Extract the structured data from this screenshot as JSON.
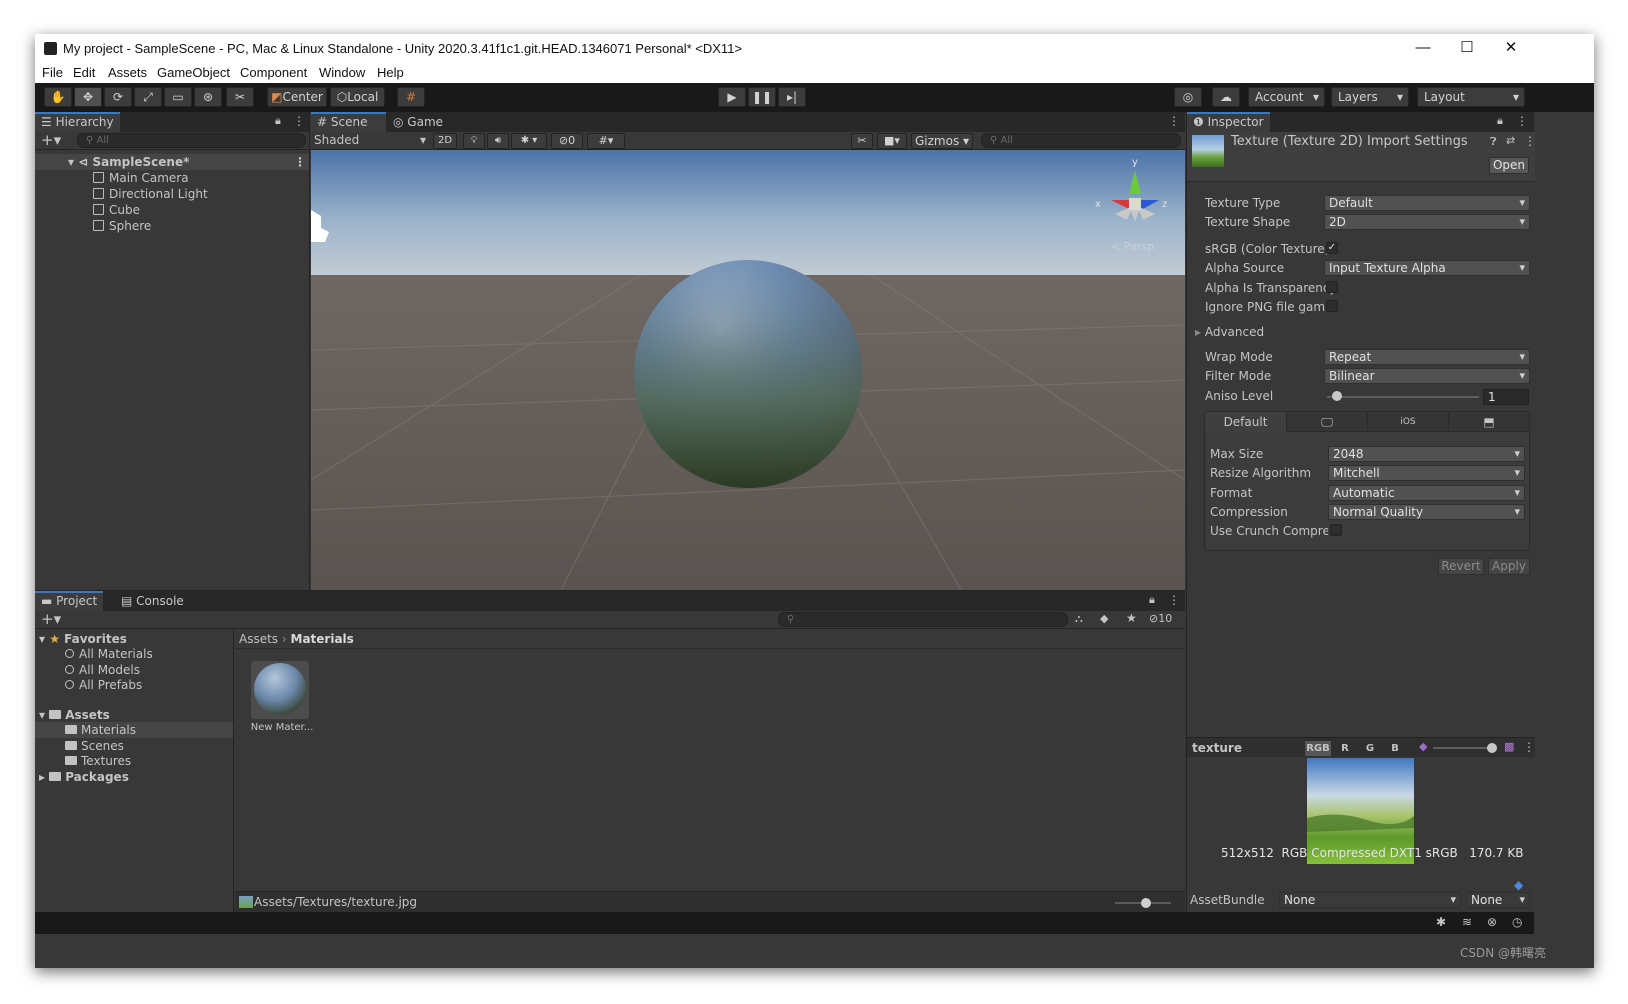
{
  "window": {
    "title": "My project - SampleScene - PC, Mac & Linux Standalone - Unity 2020.3.41f1c1.git.HEAD.1346071 Personal* <DX11>",
    "minimize": "—",
    "maximize": "☐",
    "close": "✕"
  },
  "menu": [
    "File",
    "Edit",
    "Assets",
    "GameObject",
    "Component",
    "Window",
    "Help"
  ],
  "toolbar": {
    "pivot": "Center",
    "space": "Local",
    "account": "Account",
    "layers": "Layers",
    "layout": "Layout"
  },
  "hierarchy": {
    "tab": "Hierarchy",
    "search_placeholder": "All",
    "scene": "SampleScene*",
    "items": [
      "Main Camera",
      "Directional Light",
      "Cube",
      "Sphere"
    ]
  },
  "scene_view": {
    "tab_scene": "Scene",
    "tab_game": "Game",
    "shading": "Shaded",
    "mode2d": "2D",
    "hidden_count": "0",
    "gizmos": "Gizmos",
    "search_placeholder": "All",
    "persp": "< Persp",
    "axis_x": "x",
    "axis_y": "y",
    "axis_z": "z"
  },
  "project": {
    "tab_project": "Project",
    "tab_console": "Console",
    "favorites_label": "Favorites",
    "favorites": [
      "All Materials",
      "All Models",
      "All Prefabs"
    ],
    "assets_label": "Assets",
    "asset_folders": [
      "Materials",
      "Scenes",
      "Textures"
    ],
    "packages_label": "Packages",
    "breadcrumb_root": "Assets",
    "breadcrumb_current": "Materials",
    "hidden_count": "10",
    "asset_item": "New Mater...",
    "footer_path": "Assets/Textures/texture.jpg"
  },
  "inspector": {
    "tab": "Inspector",
    "header_title": "Texture (Texture 2D) Import Settings",
    "open_button": "Open",
    "fields": {
      "texture_type_label": "Texture Type",
      "texture_type": "Default",
      "texture_shape_label": "Texture Shape",
      "texture_shape": "2D",
      "srgb_label": "sRGB (Color Texture)",
      "srgb_checked": "✓",
      "alpha_source_label": "Alpha Source",
      "alpha_source": "Input Texture Alpha",
      "alpha_transparency_label": "Alpha Is Transparency",
      "ignore_png_label": "Ignore PNG file gamm",
      "advanced_label": "Advanced",
      "wrap_mode_label": "Wrap Mode",
      "wrap_mode": "Repeat",
      "filter_mode_label": "Filter Mode",
      "filter_mode": "Bilinear",
      "aniso_label": "Aniso Level",
      "aniso_value": "1"
    },
    "platform_tabs": [
      "Default",
      "iOS"
    ],
    "platform": {
      "max_size_label": "Max Size",
      "max_size": "2048",
      "resize_label": "Resize Algorithm",
      "resize": "Mitchell",
      "format_label": "Format",
      "format": "Automatic",
      "compression_label": "Compression",
      "compression": "Normal Quality",
      "crunch_label": "Use Crunch Compress"
    },
    "revert": "Revert",
    "apply": "Apply",
    "preview": {
      "name": "texture",
      "channels": [
        "RGB",
        "R",
        "G",
        "B"
      ],
      "info": "512x512  RGB Compressed DXT1 sRGB   170.7 KB"
    },
    "asset_bundle_label": "AssetBundle",
    "asset_bundle": "None",
    "asset_bundle_variant": "None"
  },
  "watermark": "CSDN @韩曙亮"
}
